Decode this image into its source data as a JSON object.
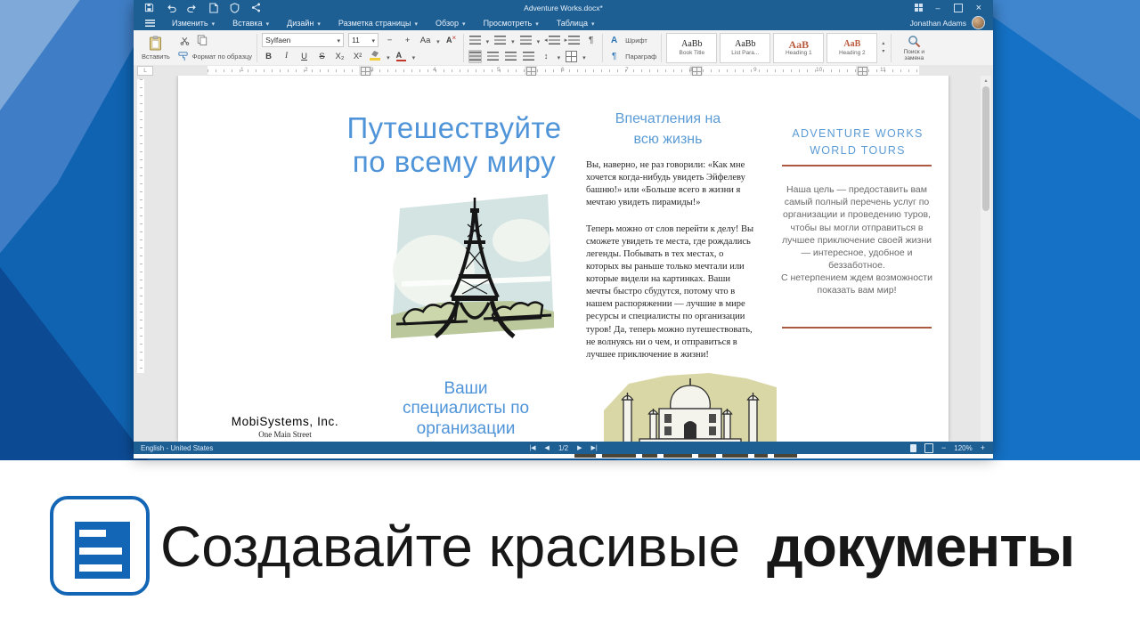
{
  "window": {
    "title": "Adventure Works.docx*",
    "account_name": "Jonathan Adams",
    "menus": [
      "Изменить",
      "Вставка",
      "Дизайн",
      "Разметка страницы",
      "Обзор",
      "Просмотреть",
      "Таблица"
    ],
    "toolbar": {
      "paste": "Вставить",
      "format_painter": "Формат по образцу",
      "font_name": "Sylfaen",
      "font_size": "11",
      "font_group": "Шрифт",
      "paragraph_group": "Параграф",
      "styles": [
        {
          "preview": "AaBb",
          "label": "Book Title"
        },
        {
          "preview": "AaBb",
          "label": "List Para..."
        },
        {
          "preview": "AaB",
          "label": "Heading 1"
        },
        {
          "preview": "AaB",
          "label": "Heading 2"
        }
      ],
      "search": "Поиск и замена"
    },
    "status": {
      "language": "English - United States",
      "page": "1/2",
      "zoom": "120%"
    }
  },
  "document": {
    "col1": {
      "title": "Путешествуйте\nпо всему миру",
      "subtitle": "Ваши\nспециалисты по\nорганизации",
      "company": "MobiSystems, Inc.",
      "address": "One Main Street"
    },
    "col2": {
      "heading": "Впечатления на\nвсю жизнь",
      "para1": "Вы, наверно, не раз говорили: «Как мне хочется когда-нибудь увидеть Эйфелеву башню!» или «Больше всего в жизни я мечтаю увидеть пирамиды!»",
      "para2": "Теперь можно от слов перейти к делу! Вы сможете увидеть те места, где рождались легенды. Побывать в тех местах, о которых вы раньше только мечтали или которые видели на картинках. Ваши мечты быстро сбудутся, потому что в нашем распоряжении — лучшие в мире ресурсы и специалисты по организации туров! Да, теперь можно путешествовать, не волнуясь ни о чем, и отправиться в лучшее приключение в жизни!"
    },
    "col3": {
      "heading": "ADVENTURE WORKS\nWORLD TOURS",
      "para1": "Наша цель — предоставить вам самый полный перечень услуг по организации и проведению туров, чтобы вы могли отправиться в лучшее приключение своей жизни — интересное, удобное и беззаботное.",
      "para2": "С нетерпением ждем возможности показать вам мир!"
    }
  },
  "ruler": {
    "numbers": [
      "1",
      "2",
      "3",
      "4",
      "5",
      "6",
      "7",
      "8",
      "9",
      "10",
      "11"
    ]
  },
  "banner": {
    "light": "Создавайте красивые",
    "bold": "документы"
  },
  "colors": {
    "accent": "#1266b5",
    "titlebar": "#1d5e93",
    "heading_blue": "#5b9bd5",
    "divider_red": "#ad5941"
  }
}
